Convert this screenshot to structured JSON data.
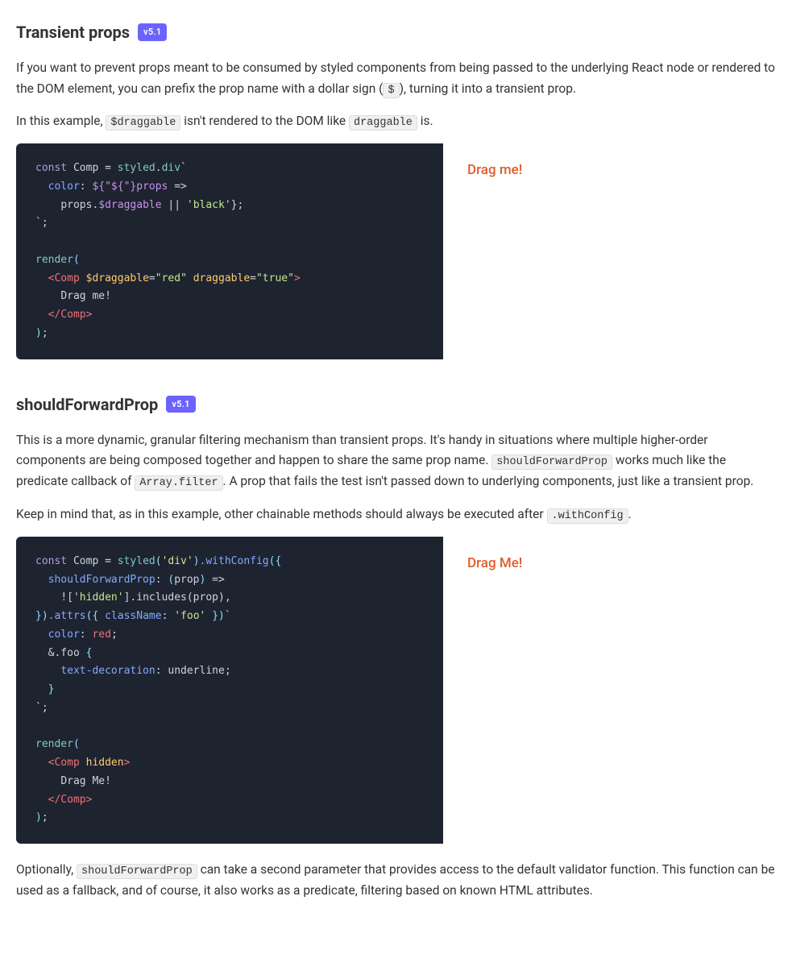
{
  "sections": [
    {
      "id": "transient-props",
      "title": "Transient props",
      "version": "v5.1",
      "paragraphs": [
        {
          "id": "p1",
          "text": "If you want to prevent props meant to be consumed by styled components from being passed to the underlying React node or rendered to the DOM element, you can prefix the prop name with a dollar sign (",
          "inline_codes": [
            "$"
          ],
          "text_after": "), turning it into a transient prop."
        },
        {
          "id": "p2",
          "text_before": "In this example, ",
          "code1": "$draggable",
          "text_middle": " isn't rendered to the DOM like ",
          "code2": "draggable",
          "text_after": " is."
        }
      ],
      "drag_label": "Drag me!",
      "code_lines": [
        {
          "type": "code",
          "content": "const_comp_styled_div"
        },
        {
          "type": "code",
          "content": "color_props_draggable"
        },
        {
          "type": "code",
          "content": "props_dollar_draggable_black"
        },
        {
          "type": "code",
          "content": "backtick_comma"
        },
        {
          "type": "blank"
        },
        {
          "type": "code",
          "content": "render"
        },
        {
          "type": "code",
          "content": "comp_dollar_draggable_red_draggable_true"
        },
        {
          "type": "code",
          "content": "drag_me_text"
        },
        {
          "type": "code",
          "content": "close_comp"
        },
        {
          "type": "code",
          "content": "close_paren_semi"
        }
      ]
    },
    {
      "id": "should-forward-prop",
      "title": "shouldForwardProp",
      "version": "v5.1",
      "paragraphs": [
        {
          "id": "p1",
          "text_before": "This is a more dynamic, granular filtering mechanism than transient props. It's handy in situations where multiple higher-order components are being composed together and happen to share the same prop name. ",
          "code1": "shouldForwardProp",
          "text_middle": " works much like the predicate callback of ",
          "code2": "Array.filter",
          "text_after": ". A prop that fails the test isn't passed down to underlying components, just like a transient prop."
        },
        {
          "id": "p2",
          "text_before": "Keep in mind that, as in this example, other chainable methods should always be executed after ",
          "code1": ".withConfig",
          "text_after": "."
        }
      ],
      "drag_label": "Drag Me!",
      "bottom_paragraphs": [
        {
          "id": "bp1",
          "text_before": "Optionally, ",
          "code1": "shouldForwardProp",
          "text_after": " can take a second parameter that provides access to the default validator function. This function can be used as a fallback, and of course, it also works as a predicate, filtering based on known HTML attributes."
        }
      ]
    }
  ],
  "colors": {
    "version_badge_bg": "#6c63ff",
    "drag_text": "#e05c2b",
    "code_bg": "#1e2330"
  }
}
